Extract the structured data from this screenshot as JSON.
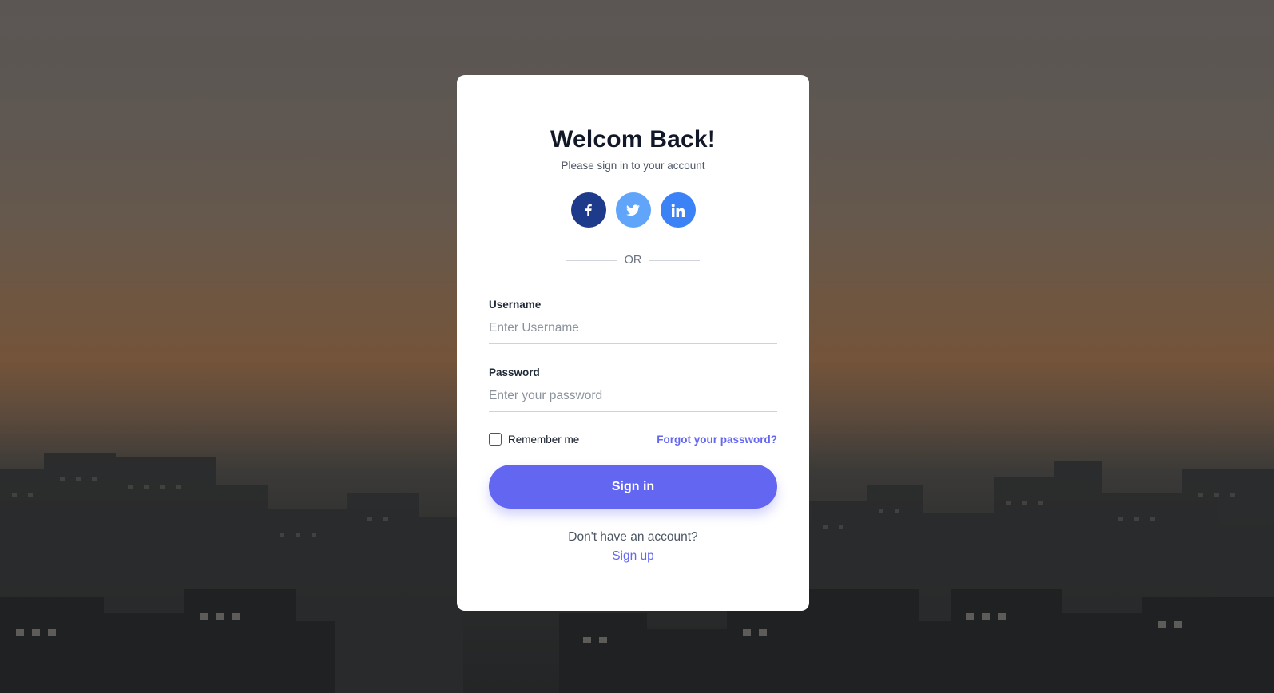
{
  "login": {
    "title": "Welcom Back!",
    "subtitle": "Please sign in to your account",
    "socials": [
      {
        "name": "facebook-icon",
        "glyph": "f",
        "color": "#1e3a8a"
      },
      {
        "name": "twitter-icon",
        "glyph": "twitter-bird",
        "color": "#60a5fa"
      },
      {
        "name": "linkedin-icon",
        "glyph": "in",
        "color": "#3b82f6"
      }
    ],
    "divider_text": "OR",
    "username": {
      "label": "Username",
      "placeholder": "Enter Username",
      "value": ""
    },
    "password": {
      "label": "Password",
      "placeholder": "Enter your password",
      "value": ""
    },
    "remember_label": "Remember me",
    "remember_checked": false,
    "forgot_label": "Forgot your password?",
    "signin_label": "Sign in",
    "no_account_text": "Don't have an account?",
    "signup_label": "Sign up"
  },
  "colors": {
    "accent": "#6366f1",
    "title": "#111827"
  }
}
